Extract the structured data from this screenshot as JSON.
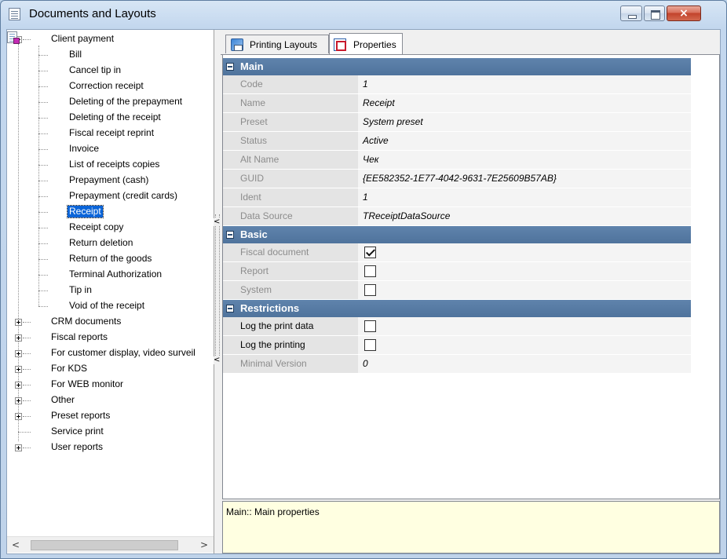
{
  "window": {
    "title": "Documents and Layouts",
    "close_glyph": "×"
  },
  "tree": {
    "root_expanded": "Client payment",
    "children": [
      "Bill",
      "Cancel tip in",
      "Correction receipt",
      "Deleting of the prepayment",
      "Deleting of the receipt",
      "Fiscal receipt reprint",
      "Invoice",
      "List of receipts copies",
      "Prepayment (cash)",
      "Prepayment (credit cards)",
      "Receipt",
      "Receipt copy",
      "Return deletion",
      "Return of the goods",
      "Terminal Authorization",
      "Tip in",
      "Void of the receipt"
    ],
    "selected": "Receipt",
    "collapsed_roots": [
      "CRM documents",
      "Fiscal reports",
      "For customer display, video surveil",
      "For KDS",
      "For WEB monitor",
      "Other",
      "Preset reports",
      "Service print",
      "User reports"
    ]
  },
  "scrollbar": {
    "left_arrow": "<",
    "right_arrow": ">"
  },
  "splitter": {
    "arrow": "<"
  },
  "tabs": [
    {
      "label": "Printing Layouts",
      "icon": "printing-layouts-icon"
    },
    {
      "label": "Properties",
      "icon": "properties-icon",
      "active": true
    }
  ],
  "properties": {
    "main": {
      "title": "Main",
      "rows": [
        {
          "name": "Code",
          "value": "1"
        },
        {
          "name": "Name",
          "value": "Receipt"
        },
        {
          "name": "Preset",
          "value": "System preset"
        },
        {
          "name": "Status",
          "value": "Active"
        },
        {
          "name": "Alt Name",
          "value": "Чек"
        },
        {
          "name": "GUID",
          "value": "{EE582352-1E77-4042-9631-7E25609B57AB}"
        },
        {
          "name": "Ident",
          "value": "1"
        },
        {
          "name": "Data Source",
          "value": "TReceiptDataSource"
        }
      ]
    },
    "basic": {
      "title": "Basic",
      "rows": [
        {
          "name": "Fiscal document",
          "checked": true
        },
        {
          "name": "Report",
          "checked": false
        },
        {
          "name": "System",
          "checked": false
        }
      ]
    },
    "restrictions": {
      "title": "Restrictions",
      "rows": [
        {
          "name": "Log the print data",
          "checked": false
        },
        {
          "name": "Log the printing",
          "checked": false
        },
        {
          "name": "Minimal Version",
          "value": "0"
        }
      ]
    }
  },
  "description": "Main:: Main properties"
}
